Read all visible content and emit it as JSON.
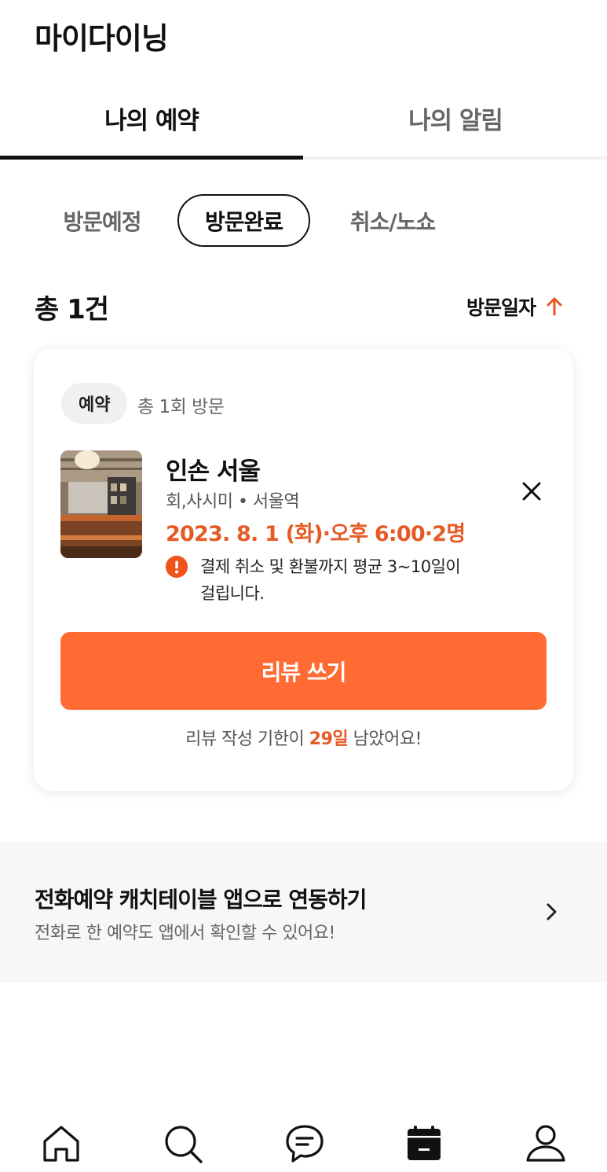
{
  "app_title": "마이다이닝",
  "tabs": [
    {
      "label": "나의 예약",
      "active": true
    },
    {
      "label": "나의 알림",
      "active": false
    }
  ],
  "filters": [
    {
      "label": "방문예정",
      "selected": false
    },
    {
      "label": "방문완료",
      "selected": true
    },
    {
      "label": "취소/노쇼",
      "selected": false
    }
  ],
  "summary": {
    "total": "총 1건",
    "sort_label": "방문일자",
    "sort_icon": "arrow-up-icon"
  },
  "reservation": {
    "badge": "예약",
    "visit_count": "총 1회 방문",
    "name": "인손 서울",
    "meta": "회,사시미 • 서울역",
    "reserve_info": "2023. 8. 1 (화)·오후 6:00·2명",
    "notice_line1": "결제 취소 및 환불까지 평균 3~10일이",
    "notice_line2": "걸립니다.",
    "review_button": "리뷰 쓰기",
    "deadline_prefix": "리뷰 작성 기한이 ",
    "deadline_days": "29일",
    "deadline_suffix": " 남았어요!"
  },
  "banner": {
    "title": "전화예약 캐치테이블 앱으로 연동하기",
    "subtitle": "전화로 한 예약도 앱에서 확인할 수 있어요!"
  },
  "bottom_nav": [
    {
      "icon": "home-icon"
    },
    {
      "icon": "search-icon"
    },
    {
      "icon": "chat-icon"
    },
    {
      "icon": "calendar-icon",
      "active": true
    },
    {
      "icon": "profile-icon"
    }
  ],
  "colors": {
    "accent": "#ff6b33",
    "accent_text": "#e55b26",
    "notice": "#f0541e"
  }
}
